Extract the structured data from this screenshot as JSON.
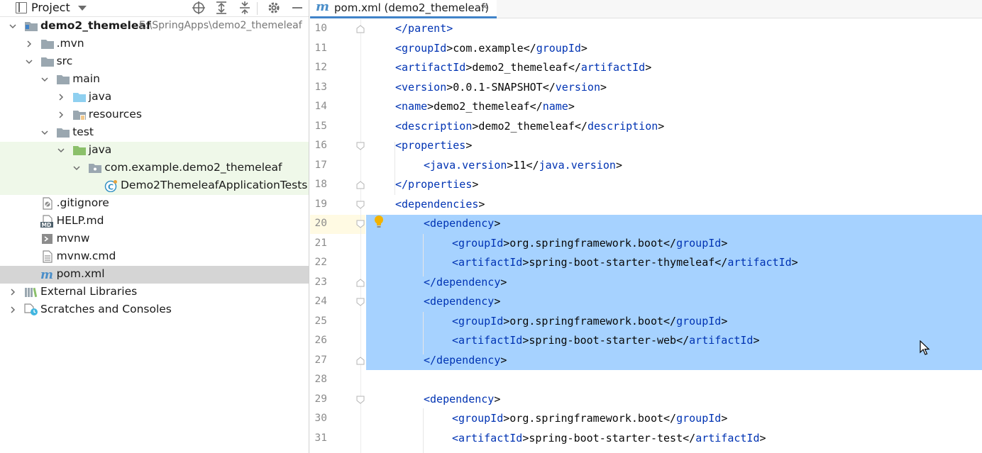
{
  "project_pane": {
    "title": "Project",
    "toolbar": [
      "target-icon",
      "expand-all-icon",
      "collapse-all-icon",
      "gear-icon",
      "minimize-icon"
    ],
    "tree": [
      {
        "label": "demo2_themeleaf",
        "path": "E:\\SpringApps\\demo2_themeleaf",
        "icon": "module-folder-icon",
        "expanded": true
      },
      {
        "label": ".mvn",
        "icon": "folder-icon",
        "expanded": false
      },
      {
        "label": "src",
        "icon": "folder-icon",
        "expanded": true
      },
      {
        "label": "main",
        "icon": "folder-icon",
        "expanded": true
      },
      {
        "label": "java",
        "icon": "source-folder-icon",
        "expanded": false
      },
      {
        "label": "resources",
        "icon": "resources-folder-icon",
        "expanded": false
      },
      {
        "label": "test",
        "icon": "folder-icon",
        "expanded": true
      },
      {
        "label": "java",
        "icon": "test-source-folder-icon",
        "expanded": true
      },
      {
        "label": "com.example.demo2_themeleaf",
        "icon": "package-icon",
        "expanded": true
      },
      {
        "label": "Demo2ThemeleafApplicationTests",
        "icon": "java-class-icon"
      },
      {
        "label": ".gitignore",
        "icon": "gitignore-file-icon"
      },
      {
        "label": "HELP.md",
        "icon": "markdown-file-icon"
      },
      {
        "label": "mvnw",
        "icon": "script-file-icon"
      },
      {
        "label": "mvnw.cmd",
        "icon": "text-file-icon"
      },
      {
        "label": "pom.xml",
        "icon": "maven-file-icon",
        "selected": true
      },
      {
        "label": "External Libraries",
        "icon": "libraries-icon",
        "expanded": false
      },
      {
        "label": "Scratches and Consoles",
        "icon": "scratches-icon",
        "expanded": false
      }
    ]
  },
  "editor": {
    "tab": {
      "icon_text": "m",
      "label": "pom.xml (demo2_themeleaf)",
      "close": "×"
    },
    "lines": [
      {
        "n": "10",
        "parts": [
          [
            "t",
            "</parent>"
          ]
        ]
      },
      {
        "n": "11",
        "parts": [
          [
            "t",
            "<groupId"
          ],
          [
            "x",
            ">com.example</"
          ],
          [
            "t",
            "groupId"
          ],
          [
            "x",
            ">"
          ]
        ]
      },
      {
        "n": "12",
        "parts": [
          [
            "t",
            "<artifactId"
          ],
          [
            "x",
            ">demo2_themeleaf</"
          ],
          [
            "t",
            "artifactId"
          ],
          [
            "x",
            ">"
          ]
        ]
      },
      {
        "n": "13",
        "parts": [
          [
            "t",
            "<version"
          ],
          [
            "x",
            ">0.0.1-SNAPSHOT</"
          ],
          [
            "t",
            "version"
          ],
          [
            "x",
            ">"
          ]
        ]
      },
      {
        "n": "14",
        "parts": [
          [
            "t",
            "<name"
          ],
          [
            "x",
            ">demo2_themeleaf</"
          ],
          [
            "t",
            "name"
          ],
          [
            "x",
            ">"
          ]
        ]
      },
      {
        "n": "15",
        "parts": [
          [
            "t",
            "<description"
          ],
          [
            "x",
            ">demo2_themeleaf</"
          ],
          [
            "t",
            "description"
          ],
          [
            "x",
            ">"
          ]
        ]
      },
      {
        "n": "16",
        "parts": [
          [
            "t",
            "<properties"
          ],
          [
            "x",
            ">"
          ]
        ]
      },
      {
        "n": "17",
        "parts": [
          [
            "t",
            "<java.version"
          ],
          [
            "x",
            ">11</"
          ],
          [
            "t",
            "java.version"
          ],
          [
            "x",
            ">"
          ]
        ]
      },
      {
        "n": "18",
        "parts": [
          [
            "t",
            "</properties"
          ],
          [
            "x",
            ">"
          ]
        ]
      },
      {
        "n": "19",
        "parts": [
          [
            "t",
            "<dependencies"
          ],
          [
            "x",
            ">"
          ]
        ]
      },
      {
        "n": "20",
        "parts": [
          [
            "t",
            "<dependency"
          ],
          [
            "x",
            ">"
          ]
        ]
      },
      {
        "n": "21",
        "parts": [
          [
            "t",
            "<groupId"
          ],
          [
            "x",
            ">org.springframework.boot</"
          ],
          [
            "t",
            "groupId"
          ],
          [
            "x",
            ">"
          ]
        ]
      },
      {
        "n": "22",
        "parts": [
          [
            "t",
            "<artifactId"
          ],
          [
            "x",
            ">spring-boot-starter-thymeleaf</"
          ],
          [
            "t",
            "artifactId"
          ],
          [
            "x",
            ">"
          ]
        ]
      },
      {
        "n": "23",
        "parts": [
          [
            "t",
            "</dependency"
          ],
          [
            "x",
            ">"
          ]
        ]
      },
      {
        "n": "24",
        "parts": [
          [
            "t",
            "<dependency"
          ],
          [
            "x",
            ">"
          ]
        ]
      },
      {
        "n": "25",
        "parts": [
          [
            "t",
            "<groupId"
          ],
          [
            "x",
            ">org.springframework.boot</"
          ],
          [
            "t",
            "groupId"
          ],
          [
            "x",
            ">"
          ]
        ]
      },
      {
        "n": "26",
        "parts": [
          [
            "t",
            "<artifactId"
          ],
          [
            "x",
            ">spring-boot-starter-web</"
          ],
          [
            "t",
            "artifactId"
          ],
          [
            "x",
            ">"
          ]
        ]
      },
      {
        "n": "27",
        "parts": [
          [
            "t",
            "</dependency"
          ],
          [
            "x",
            ">"
          ]
        ]
      },
      {
        "n": "28",
        "parts": []
      },
      {
        "n": "29",
        "parts": [
          [
            "t",
            "<dependency"
          ],
          [
            "x",
            ">"
          ]
        ]
      },
      {
        "n": "30",
        "parts": [
          [
            "t",
            "<groupId"
          ],
          [
            "x",
            ">org.springframework.boot</"
          ],
          [
            "t",
            "groupId"
          ],
          [
            "x",
            ">"
          ]
        ]
      },
      {
        "n": "31",
        "parts": [
          [
            "t",
            "<artifactId"
          ],
          [
            "x",
            ">spring-boot-starter-test</"
          ],
          [
            "t",
            "artifactId"
          ],
          [
            "x",
            ">"
          ]
        ]
      }
    ],
    "colors": {
      "tag": "#0033b3",
      "text": "#080808",
      "selection": "#a6d2ff",
      "test_folder_bg": "#eff8e9",
      "selected_row": "#d5d5d5"
    }
  }
}
